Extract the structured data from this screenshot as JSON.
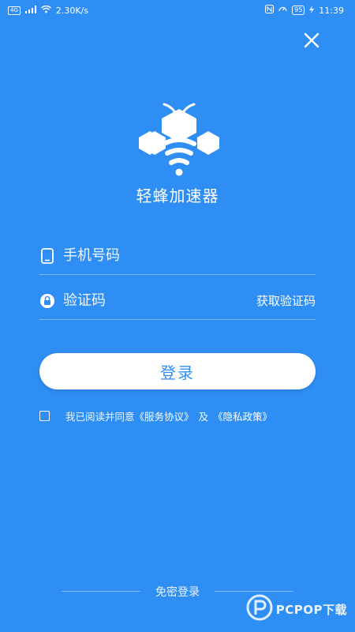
{
  "status_bar": {
    "left_tag": "4G",
    "network_speed": "2.30K/s",
    "battery": "95",
    "time": "11:39"
  },
  "icons": {
    "close": "close-icon",
    "logo": "bee-logo-icon",
    "phone": "phone-icon",
    "lock": "lock-icon"
  },
  "app": {
    "name": "轻蜂加速器"
  },
  "form": {
    "phone_placeholder": "手机号码",
    "code_placeholder": "验证码",
    "get_code_label": "获取验证码",
    "login_label": "登录"
  },
  "agreement": {
    "prefix": "我已阅读并同意",
    "service_link": "《服务协议》",
    "and": "及",
    "privacy_link": "《隐私政策》"
  },
  "passwordless_label": "免密登录",
  "watermark": "PCPOP下载",
  "colors": {
    "background": "#2f8ef4",
    "logo_blue": "#2f8ef4",
    "white": "#ffffff"
  }
}
